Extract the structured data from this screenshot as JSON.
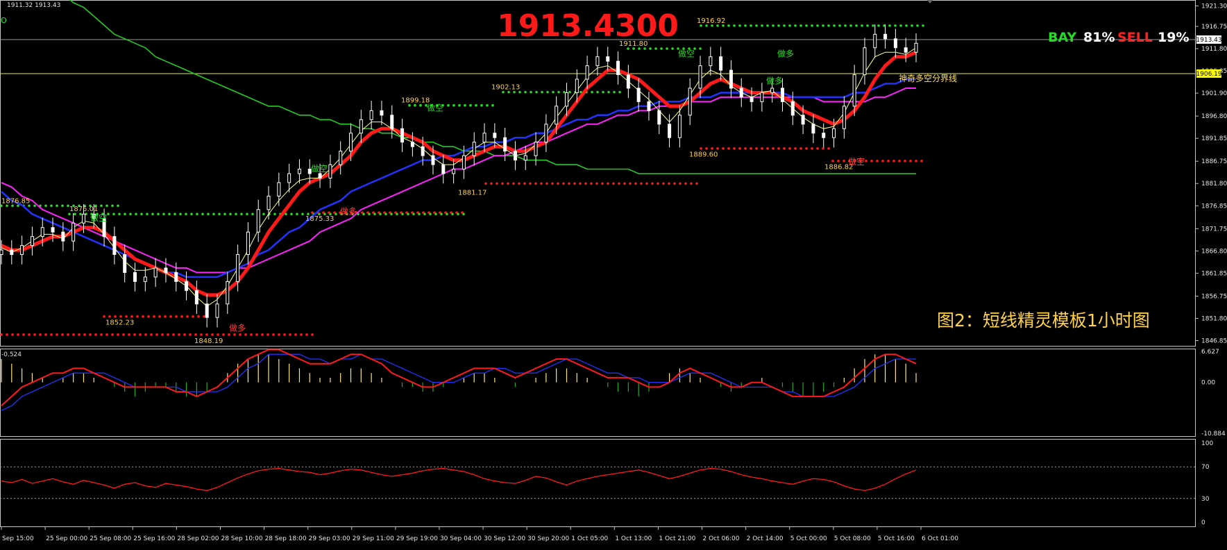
{
  "window": {
    "ohlc_text": "1911.32 1913.43",
    "top_left_marker": "O"
  },
  "price_banner": "1913.4300",
  "sentiment": {
    "buy_label": "BAY",
    "buy_pct": "81%",
    "sell_label": "SELL",
    "sell_pct": "19%",
    "buy_color": "#22dd22",
    "sell_color": "#ff2020"
  },
  "caption": "图2：短线精灵模板1小时图",
  "current_price_tag": "1913.43",
  "boundary_price_tag": "1906.19",
  "boundary_label": "神奇多空分界线",
  "colors": {
    "bull_candle": "#ffffff",
    "bear_candle": "#ffffff",
    "ma_green": "#22cc22",
    "ma_blue": "#2233ff",
    "ma_magenta": "#ff22ff",
    "ma_yellow": "#ffff88",
    "signal_red": "#ff1a1a",
    "signal_green": "#22dd22",
    "gold_text": "#ffd24a",
    "grid_axis": "#c0c0c0"
  },
  "chart_data": [
    {
      "type": "candlestick",
      "panel": "price",
      "y_ticks": [
        "1921.30",
        "1916.75",
        "1911.80",
        "1906.85",
        "1901.90",
        "1896.80",
        "1891.85",
        "1886.75",
        "1881.80",
        "1876.85",
        "1871.75",
        "1866.80",
        "1861.85",
        "1856.75",
        "1851.80",
        "1846.85"
      ],
      "ylim": [
        1846.0,
        1922.0
      ],
      "x_ticks": [
        "Sep 15:00",
        "25 Sep 00:00",
        "25 Sep 08:00",
        "25 Sep 16:00",
        "28 Sep 02:00",
        "28 Sep 10:00",
        "28 Sep 18:00",
        "29 Sep 03:00",
        "29 Sep 11:00",
        "29 Sep 19:00",
        "30 Sep 04:00",
        "30 Sep 12:00",
        "30 Sep 20:00",
        "1 Oct 05:00",
        "1 Oct 13:00",
        "1 Oct 21:00",
        "2 Oct 06:00",
        "2 Oct 14:00",
        "5 Oct 00:00",
        "5 Oct 08:00",
        "5 Oct 16:00",
        "6 Oct 01:00"
      ],
      "annotations_prices": [
        "1876.85",
        "1875.01",
        "1852.23",
        "1848.19",
        "1875.33",
        "1899.18",
        "1881.17",
        "1902.13",
        "1911.80",
        "1916.92",
        "1889.60",
        "1886.82"
      ],
      "annotation_words": [
        "做空",
        "做多",
        "做空",
        "做多",
        "做空",
        "做空",
        "做多",
        "做空",
        "做多"
      ],
      "close_series": [
        1867,
        1866,
        1868,
        1870,
        1872,
        1871,
        1869,
        1873,
        1875,
        1874,
        1870,
        1866,
        1862,
        1860,
        1861,
        1863,
        1862,
        1860,
        1858,
        1855,
        1852,
        1855,
        1860,
        1866,
        1871,
        1876,
        1879,
        1882,
        1884,
        1885,
        1884,
        1883,
        1886,
        1889,
        1893,
        1896,
        1898,
        1897,
        1894,
        1891,
        1890,
        1888,
        1886,
        1884,
        1885,
        1888,
        1891,
        1893,
        1892,
        1889,
        1887,
        1888,
        1891,
        1895,
        1899,
        1902,
        1905,
        1908,
        1910,
        1909,
        1906,
        1903,
        1900,
        1898,
        1895,
        1892,
        1897,
        1903,
        1908,
        1910,
        1907,
        1903,
        1901,
        1900,
        1902,
        1903,
        1900,
        1897,
        1895,
        1893,
        1892,
        1894,
        1899,
        1906,
        1912,
        1915,
        1914,
        1912,
        1911,
        1913
      ],
      "ma_fast": [
        1868,
        1867,
        1867,
        1868,
        1869,
        1870,
        1870,
        1871,
        1872,
        1872,
        1871,
        1869,
        1867,
        1865,
        1864,
        1863,
        1862,
        1861,
        1860,
        1858,
        1857,
        1857,
        1858,
        1860,
        1863,
        1867,
        1871,
        1874,
        1877,
        1880,
        1882,
        1883,
        1884,
        1886,
        1888,
        1891,
        1893,
        1894,
        1894,
        1893,
        1892,
        1891,
        1889,
        1888,
        1887,
        1887,
        1888,
        1889,
        1890,
        1890,
        1889,
        1889,
        1890,
        1891,
        1894,
        1897,
        1900,
        1903,
        1905,
        1907,
        1907,
        1906,
        1905,
        1903,
        1901,
        1899,
        1899,
        1900,
        1902,
        1904,
        1905,
        1904,
        1903,
        1902,
        1902,
        1902,
        1901,
        1900,
        1898,
        1897,
        1896,
        1895,
        1896,
        1898,
        1901,
        1905,
        1908,
        1910,
        1910,
        1911
      ],
      "ma_blue": [
        1880,
        1878,
        1877,
        1875,
        1874,
        1873,
        1872,
        1871,
        1870,
        1869,
        1868,
        1867,
        1866,
        1865,
        1864,
        1863,
        1862,
        1862,
        1861,
        1861,
        1861,
        1861,
        1862,
        1863,
        1864,
        1866,
        1867,
        1869,
        1871,
        1872,
        1874,
        1876,
        1877,
        1878,
        1880,
        1881,
        1882,
        1883,
        1884,
        1885,
        1886,
        1887,
        1887,
        1888,
        1888,
        1889,
        1890,
        1890,
        1891,
        1891,
        1892,
        1892,
        1893,
        1893,
        1894,
        1895,
        1896,
        1896,
        1897,
        1897,
        1898,
        1898,
        1899,
        1899,
        1900,
        1900,
        1900,
        1901,
        1901,
        1901,
        1902,
        1902,
        1902,
        1902,
        1902,
        1902,
        1902,
        1901,
        1901,
        1901,
        1901,
        1901,
        1901,
        1902,
        1902,
        1903,
        1904,
        1904,
        1905,
        1905
      ],
      "ma_magenta": [
        1882,
        1881,
        1879,
        1878,
        1876,
        1875,
        1874,
        1873,
        1872,
        1871,
        1870,
        1869,
        1868,
        1867,
        1866,
        1865,
        1864,
        1863,
        1863,
        1862,
        1862,
        1862,
        1862,
        1863,
        1863,
        1864,
        1865,
        1866,
        1867,
        1868,
        1869,
        1871,
        1872,
        1873,
        1874,
        1876,
        1877,
        1878,
        1879,
        1880,
        1881,
        1882,
        1883,
        1884,
        1885,
        1885,
        1886,
        1887,
        1888,
        1888,
        1889,
        1890,
        1891,
        1891,
        1892,
        1893,
        1894,
        1895,
        1895,
        1896,
        1897,
        1897,
        1898,
        1898,
        1899,
        1899,
        1899,
        1900,
        1900,
        1900,
        1901,
        1901,
        1901,
        1901,
        1901,
        1901,
        1901,
        1901,
        1901,
        1901,
        1900,
        1900,
        1900,
        1900,
        1900,
        1901,
        1901,
        1902,
        1903,
        1903
      ],
      "ma_green_long": [
        1936,
        1934,
        1932,
        1930,
        1928,
        1926,
        1924,
        1922,
        1921,
        1919,
        1917,
        1915,
        1914,
        1913,
        1912,
        1910,
        1909,
        1908,
        1907,
        1906,
        1905,
        1904,
        1903,
        1902,
        1901,
        1900,
        1899,
        1899,
        1898,
        1897,
        1897,
        1896,
        1896,
        1895,
        1895,
        1894,
        1894,
        1893,
        1893,
        1892,
        1892,
        1891,
        1891,
        1890,
        1890,
        1889,
        1889,
        1889,
        1888,
        1888,
        1888,
        1887,
        1887,
        1887,
        1886,
        1886,
        1886,
        1885,
        1885,
        1885,
        1885,
        1885,
        1884,
        1884,
        1884,
        1884,
        1884,
        1884,
        1884,
        1884,
        1884,
        1884,
        1884,
        1884,
        1884,
        1884,
        1884,
        1884,
        1884,
        1884,
        1884,
        1884,
        1884,
        1884,
        1884,
        1884,
        1884,
        1884,
        1884,
        1884
      ]
    },
    {
      "type": "line",
      "panel": "macd",
      "header": "-0.524",
      "y_ticks": [
        "6.627",
        "0.00",
        "-10.884"
      ],
      "ylim": [
        -10.884,
        6.627
      ],
      "histogram": [
        5,
        4,
        3,
        2,
        1,
        0,
        1,
        2,
        2,
        1,
        0,
        -1,
        -2,
        -3,
        -2,
        -1,
        -1,
        -2,
        -3,
        -3,
        -2,
        0,
        2,
        4,
        5,
        6,
        6,
        5,
        4,
        3,
        2,
        1,
        1,
        2,
        3,
        3,
        2,
        1,
        0,
        -1,
        -1,
        -2,
        -2,
        -1,
        0,
        1,
        2,
        2,
        1,
        0,
        -1,
        0,
        1,
        2,
        3,
        3,
        2,
        1,
        0,
        -1,
        -2,
        -2,
        -3,
        -2,
        0,
        2,
        3,
        2,
        1,
        0,
        -1,
        -2,
        -1,
        0,
        1,
        0,
        -1,
        -2,
        -3,
        -3,
        -2,
        -1,
        1,
        3,
        5,
        6,
        6,
        5,
        4,
        2
      ],
      "macd_line": [
        -5,
        -3,
        -1,
        0,
        1,
        2,
        2,
        3,
        3,
        2,
        1,
        0,
        -1,
        -1,
        -1,
        -1,
        -1,
        -2,
        -2,
        -3,
        -2,
        -1,
        1,
        3,
        5,
        6,
        7,
        7,
        6,
        5,
        4,
        4,
        4,
        5,
        6,
        6,
        5,
        4,
        2,
        1,
        0,
        -1,
        -1,
        0,
        1,
        2,
        3,
        3,
        3,
        2,
        1,
        2,
        3,
        4,
        5,
        5,
        4,
        3,
        2,
        1,
        1,
        1,
        0,
        -1,
        -1,
        0,
        2,
        3,
        2,
        1,
        0,
        -1,
        -1,
        0,
        0,
        -1,
        -2,
        -3,
        -3,
        -3,
        -3,
        -2,
        -1,
        1,
        3,
        5,
        6,
        6,
        5,
        4
      ],
      "signal_line": [
        -6,
        -5,
        -3,
        -2,
        -1,
        0,
        1,
        2,
        2,
        2,
        2,
        1,
        0,
        -1,
        -1,
        -1,
        -1,
        -1,
        -2,
        -2,
        -2,
        -2,
        -1,
        1,
        3,
        4,
        6,
        6,
        6,
        6,
        5,
        5,
        4,
        5,
        5,
        6,
        5,
        5,
        4,
        3,
        2,
        1,
        0,
        0,
        0,
        1,
        2,
        2,
        3,
        3,
        2,
        2,
        2,
        3,
        4,
        5,
        5,
        4,
        3,
        2,
        2,
        1,
        1,
        0,
        0,
        0,
        1,
        2,
        2,
        2,
        1,
        0,
        -1,
        -1,
        -1,
        -1,
        -2,
        -2,
        -3,
        -3,
        -3,
        -3,
        -2,
        -1,
        1,
        3,
        4,
        5,
        5,
        5
      ]
    },
    {
      "type": "line",
      "panel": "oscillator",
      "y_ticks": [
        "100",
        "70",
        "30",
        "0"
      ],
      "ylim": [
        0,
        100
      ],
      "levels": [
        70,
        30
      ],
      "values": [
        52,
        50,
        54,
        49,
        52,
        55,
        51,
        48,
        53,
        50,
        47,
        43,
        48,
        50,
        46,
        44,
        49,
        47,
        45,
        42,
        40,
        44,
        50,
        56,
        61,
        65,
        67,
        68,
        66,
        64,
        63,
        60,
        62,
        65,
        67,
        66,
        63,
        60,
        58,
        60,
        62,
        65,
        67,
        68,
        66,
        64,
        60,
        55,
        52,
        50,
        49,
        53,
        58,
        56,
        51,
        47,
        52,
        55,
        58,
        60,
        62,
        64,
        66,
        63,
        59,
        55,
        58,
        62,
        66,
        68,
        67,
        64,
        60,
        57,
        55,
        52,
        50,
        48,
        52,
        55,
        54,
        51,
        46,
        42,
        40,
        43,
        48,
        55,
        61,
        66
      ]
    }
  ]
}
